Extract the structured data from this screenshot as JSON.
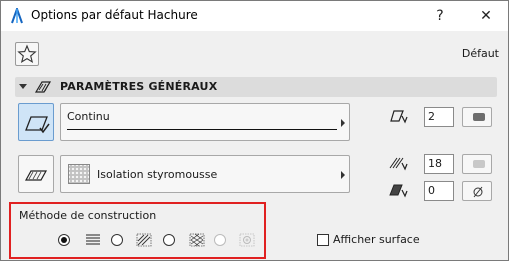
{
  "window": {
    "title": "Options par défaut Hachure",
    "help_label": "?",
    "close_label": "✕"
  },
  "toolbar": {
    "default_label": "Défaut"
  },
  "section": {
    "title": "PARAMÈTRES GÉNÉRAUX"
  },
  "line_type": {
    "value": "Continu"
  },
  "fill": {
    "value": "Isolation styromousse"
  },
  "fields": {
    "line_pen": "2",
    "fill_pen": "18",
    "background_pen": "0"
  },
  "method": {
    "title": "Méthode de construction",
    "options": [
      {
        "icon": "horizontal-lines-icon",
        "selected": true,
        "enabled": true
      },
      {
        "icon": "diagonal-hatch-icon",
        "selected": false,
        "enabled": true
      },
      {
        "icon": "crosshatch-pattern-icon",
        "selected": false,
        "enabled": true
      },
      {
        "icon": "image-fill-icon",
        "selected": false,
        "enabled": false
      }
    ]
  },
  "show_surface": {
    "label": "Afficher surface",
    "checked": false
  },
  "colors": {
    "selected_bg": "#cfe4f7",
    "highlight_border": "#e02020",
    "pen_swatch_dark": "#6e6e6e",
    "pen_swatch_light": "#c8c8c8"
  }
}
